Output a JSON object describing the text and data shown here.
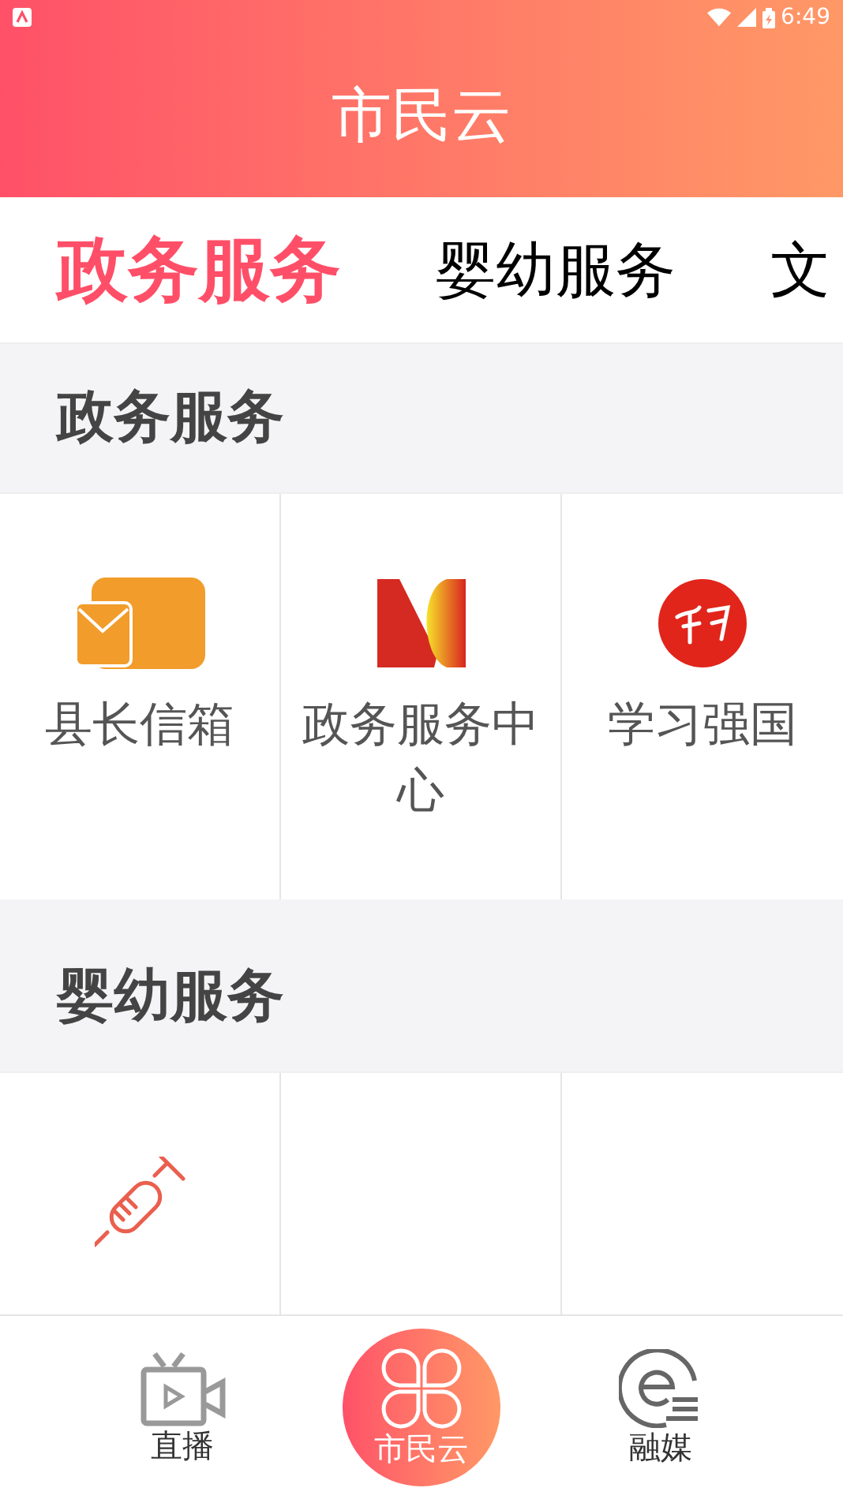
{
  "status_bar": {
    "time": "6:49"
  },
  "header": {
    "title": "市民云"
  },
  "tabs": [
    {
      "label": "政务服务",
      "selected": true
    },
    {
      "label": "婴幼服务",
      "selected": false
    },
    {
      "label": "文",
      "selected": false
    }
  ],
  "sections": [
    {
      "title": "政务服务",
      "items": [
        {
          "kind": "labeled",
          "label": "县长信箱"
        },
        {
          "kind": "labeled",
          "label": "政务服务中心"
        },
        {
          "kind": "labeled",
          "label": "学习强国"
        }
      ]
    },
    {
      "title": "婴幼服务",
      "items": [
        {
          "kind": "icon"
        }
      ]
    }
  ],
  "bottom_nav": [
    {
      "label": "直播",
      "selected": false
    },
    {
      "label": "市民云",
      "selected": true
    },
    {
      "label": "融媒",
      "selected": false
    }
  ]
}
